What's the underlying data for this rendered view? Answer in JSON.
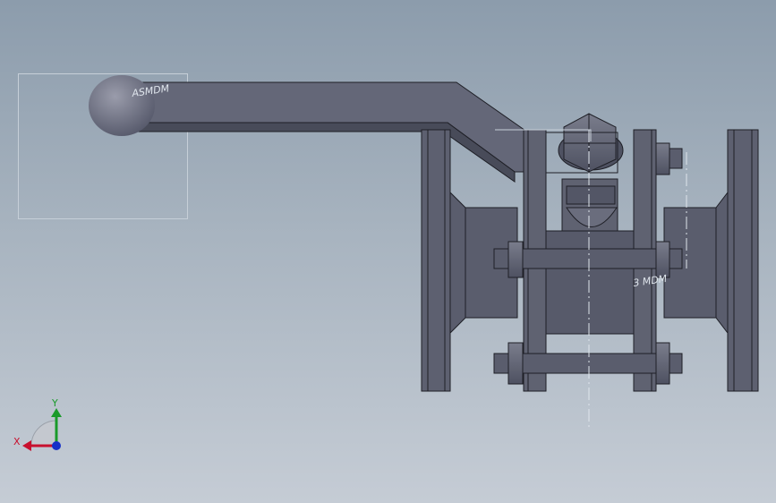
{
  "viewport": {
    "background_top": "#8c9cac",
    "background_bottom": "#c5ccd5"
  },
  "annotations": {
    "handle_note": "ASMDM",
    "body_note": "3 MDM"
  },
  "triad": {
    "x_label": "X",
    "y_label": "Y",
    "x_color": "#c8102e",
    "y_color": "#1a9a2a",
    "z_color": "#1630c8"
  },
  "model": {
    "part_color": "#5f6271",
    "edge_color": "#1e1f26"
  }
}
